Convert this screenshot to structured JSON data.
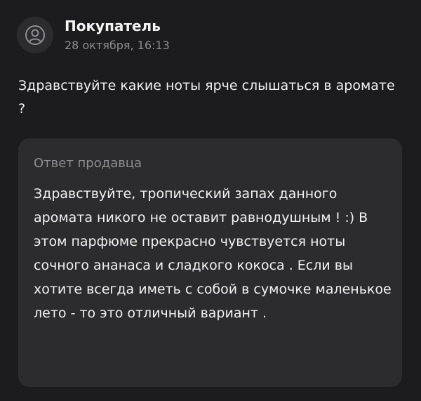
{
  "author": {
    "name": "Покупатель",
    "date": "28 октября, 16:13",
    "avatar_icon": "user-icon"
  },
  "question": {
    "text": "Здравствуйте какие ноты ярче слышаться в аромате ?"
  },
  "answer": {
    "title": "Ответ продавца",
    "text": "Здравствуйте, тропический запах данного аромата никого не оставит равнодушным !   :) В этом парфюме прекрасно чувствуется ноты сочного ананаса  и сладкого кокоса .  Если вы хотите всегда иметь с собой в сумочке маленькое лето - то это отличный вариант ."
  },
  "colors": {
    "background": "#1c1c1e",
    "card": "#2c2c2e",
    "secondary_text": "#8e8e93",
    "primary_text": "#f2f2f2"
  }
}
